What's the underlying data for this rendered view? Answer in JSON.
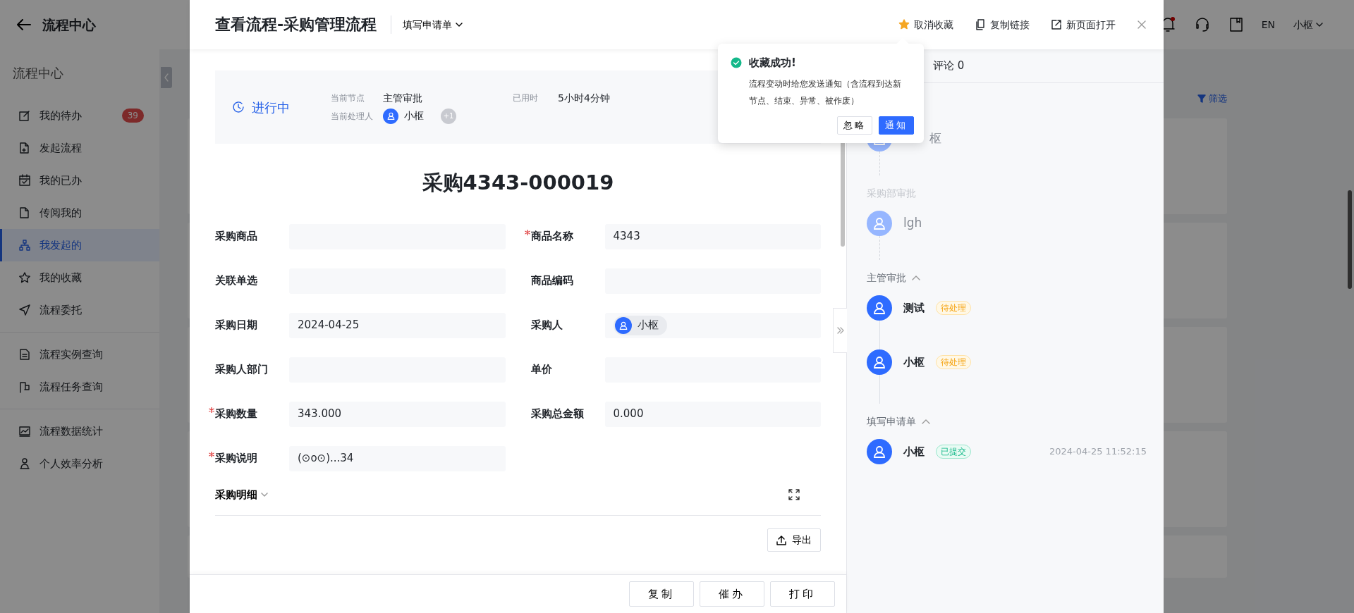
{
  "app_header": {
    "title": "流程中心",
    "unread": true,
    "language": "EN",
    "user": "小枢"
  },
  "sidebar": {
    "title": "流程中心",
    "groups": [
      [
        {
          "label": "我的待办",
          "badge": "39",
          "selected": false
        },
        {
          "label": "发起流程",
          "selected": false
        },
        {
          "label": "我的已办",
          "selected": false
        },
        {
          "label": "传阅我的",
          "selected": false
        },
        {
          "label": "我发起的",
          "selected": true
        },
        {
          "label": "我的收藏",
          "selected": false
        },
        {
          "label": "流程委托",
          "selected": false
        }
      ],
      [
        {
          "label": "流程实例查询",
          "selected": false
        },
        {
          "label": "流程任务查询",
          "selected": false
        }
      ],
      [
        {
          "label": "流程数据统计",
          "selected": false
        },
        {
          "label": "个人效率分析",
          "selected": false
        }
      ]
    ]
  },
  "content": {
    "filter": "筛选"
  },
  "modal": {
    "title": "查看流程-采购管理流程",
    "stage_menu": "填写申请单",
    "favorited": true,
    "actions": [
      "取消收藏",
      "复制链接",
      "新页面打开"
    ],
    "status": {
      "state": "进行中",
      "node_label": "当前节点",
      "node": "主管审批",
      "elapsed_label": "已用时",
      "elapsed": "5小时4分钟",
      "handler_label": "当前处理人",
      "handler": "小枢",
      "more": "+1"
    },
    "form": {
      "title": "采购4343-000019",
      "fields": [
        {
          "label": "采购商品",
          "required": false,
          "kind": "text"
        },
        {
          "label": "商品名称",
          "required": true,
          "kind": "text",
          "value": "4343"
        },
        {
          "label": "关联单选",
          "required": false,
          "kind": "text"
        },
        {
          "label": "商品编码",
          "required": false,
          "kind": "text"
        },
        {
          "label": "采购日期",
          "required": false,
          "kind": "text",
          "value": "2024-04-25"
        },
        {
          "label": "采购人",
          "required": false,
          "kind": "user",
          "value": "小枢"
        },
        {
          "label": "采购人部门",
          "required": false,
          "kind": "text"
        },
        {
          "label": "单价",
          "required": false,
          "kind": "text"
        },
        {
          "label": "采购数量",
          "required": true,
          "kind": "text",
          "value": "343.000"
        },
        {
          "label": "采购总金额",
          "required": false,
          "kind": "text",
          "value": "0.000"
        },
        {
          "label": "采购说明",
          "required": true,
          "kind": "text",
          "value": "(⊙o⊙)...34"
        }
      ],
      "detail": {
        "label": "采购明细",
        "expanded": false,
        "export": "导出"
      }
    },
    "footer_buttons": [
      "复制",
      "催办",
      "打印"
    ],
    "side_panel": {
      "tabs": [
        {
          "label": "评论 0",
          "selected": false
        }
      ],
      "timeline": [
        {
          "kind": "upcoming",
          "nodes": [
            {
              "name": "枢"
            }
          ]
        },
        {
          "stage": "采购部审批",
          "kind": "upcoming",
          "nodes": [
            {
              "name": "lgh"
            }
          ]
        },
        {
          "stage": "主管审批",
          "kind": "active",
          "expanded": true,
          "nodes": [
            {
              "name": "测试",
              "tag": "待处理",
              "kind": "pending"
            },
            {
              "name": "小枢",
              "tag": "待处理",
              "kind": "pending"
            }
          ]
        },
        {
          "stage": "填写申请单",
          "kind": "active",
          "expanded": true,
          "nodes": [
            {
              "name": "小枢",
              "tag": "已提交",
              "kind": "submitted",
              "time": "2024-04-25 11:52:15"
            }
          ]
        }
      ]
    },
    "popover": {
      "title": "收藏成功!",
      "message": "流程变动时给您发送通知（含流程到达新节点、结束、异常、被作废）",
      "buttons": [
        {
          "label": "忽略",
          "primary": false
        },
        {
          "label": "通知",
          "primary": true
        }
      ]
    }
  }
}
